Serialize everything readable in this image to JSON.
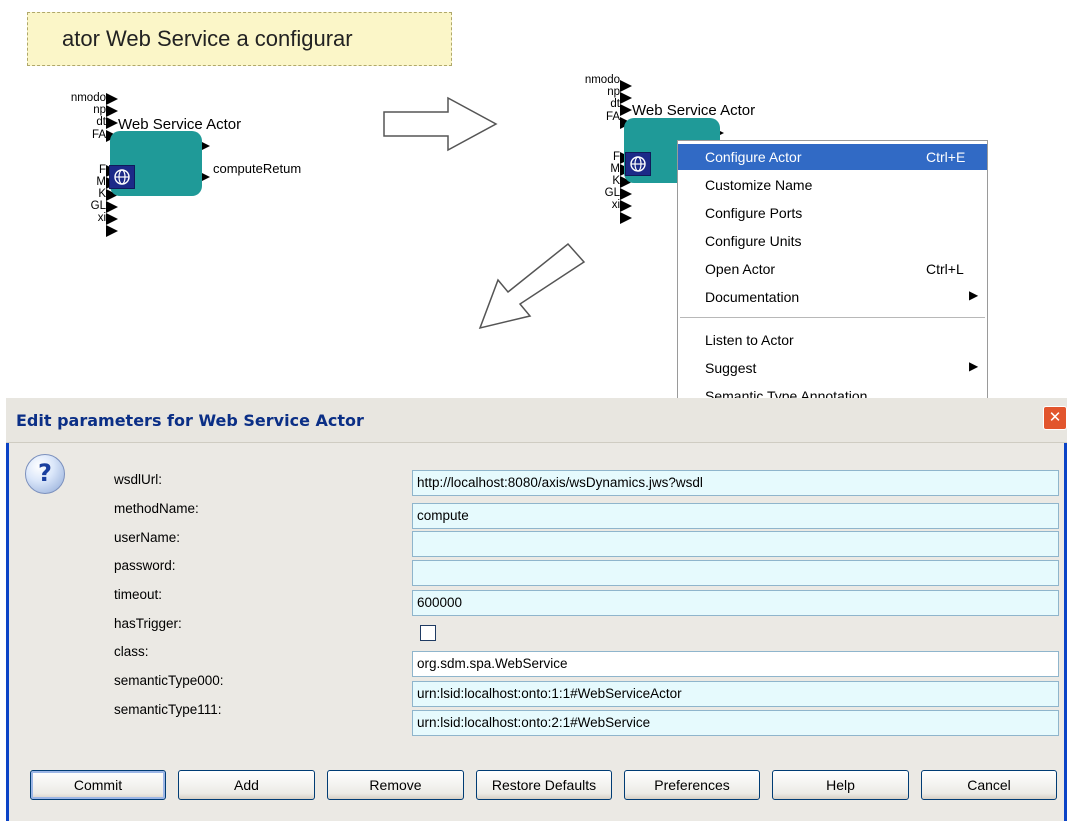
{
  "callout": {
    "text": "ator Web Service a configurar"
  },
  "actor": {
    "title": "Web Service Actor",
    "input_ports": [
      "nmodo",
      "np",
      "dt",
      "FA",
      "F",
      "M",
      "K",
      "GL",
      "xi"
    ],
    "output_port": "computeRetum"
  },
  "context_menu": {
    "items": [
      {
        "label": "Configure Actor",
        "accel": "Ctrl+E"
      },
      {
        "label": "Customize Name",
        "accel": ""
      },
      {
        "label": "Configure Ports",
        "accel": ""
      },
      {
        "label": "Configure Units",
        "accel": ""
      },
      {
        "label": "Open Actor",
        "accel": "Ctrl+L"
      },
      {
        "label": "Documentation",
        "accel": ""
      },
      {
        "label": "Listen to Actor",
        "accel": ""
      },
      {
        "label": "Suggest",
        "accel": ""
      },
      {
        "label": "Semantic Type Annotation",
        "accel": ""
      }
    ],
    "submenu_arrow": "▶"
  },
  "dialog": {
    "title": "Edit parameters for Web Service Actor",
    "close": "✕",
    "help_icon": "?",
    "params": [
      {
        "label": "wsdlUrl:",
        "value": "http://localhost:8080/axis/wsDynamics.jws?wsdl"
      },
      {
        "label": "methodName:",
        "value": "compute"
      },
      {
        "label": "userName:",
        "value": ""
      },
      {
        "label": "password:",
        "value": ""
      },
      {
        "label": "timeout:",
        "value": "600000"
      },
      {
        "label": "hasTrigger:",
        "value": ""
      },
      {
        "label": "class:",
        "value": "org.sdm.spa.WebService"
      },
      {
        "label": "semanticType000:",
        "value": "urn:lsid:localhost:onto:1:1#WebServiceActor"
      },
      {
        "label": "semanticType111:",
        "value": "urn:lsid:localhost:onto:2:1#WebService"
      }
    ],
    "has_trigger_checked": false,
    "buttons": {
      "commit": "Commit",
      "add": "Add",
      "remove": "Remove",
      "restore": "Restore Defaults",
      "preferences": "Preferences",
      "help": "Help",
      "cancel": "Cancel"
    }
  },
  "colors": {
    "actor_body": "#1f9a98",
    "menu_highlight": "#316ac5",
    "field_bg": "#e6fafd",
    "title_text": "#0b2f86"
  }
}
